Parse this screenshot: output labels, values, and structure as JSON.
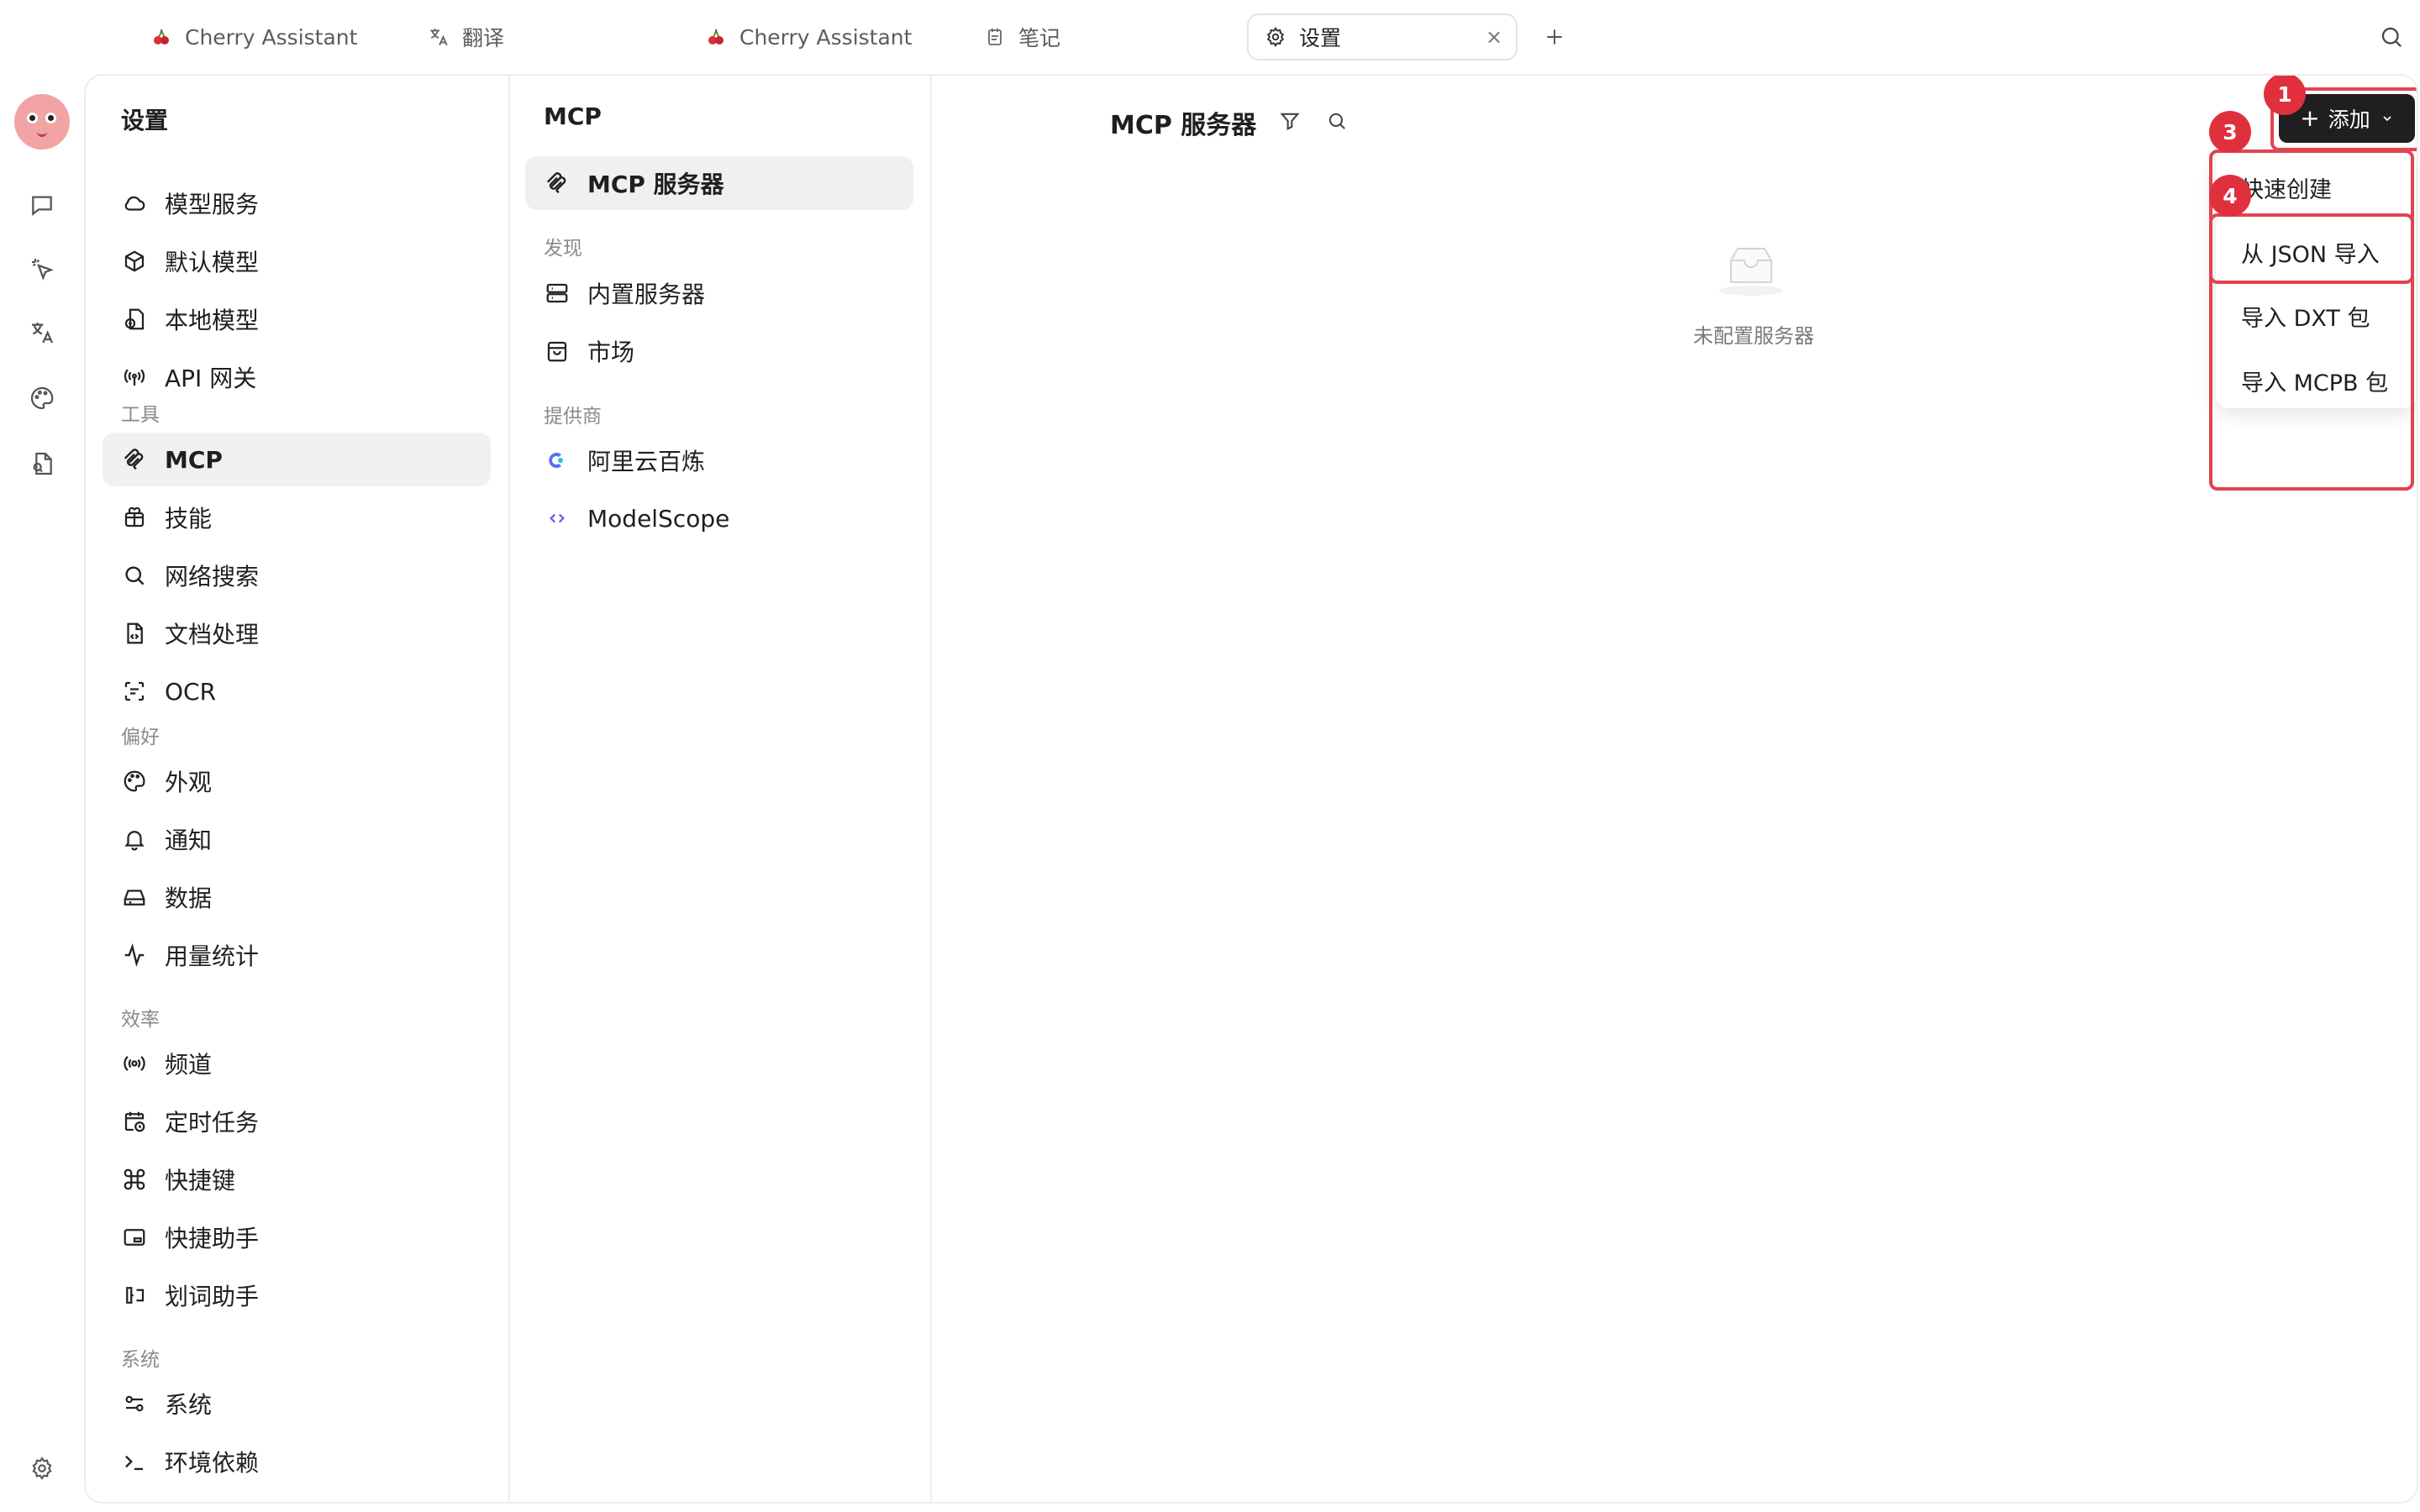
{
  "tabs": [
    {
      "label": "Cherry Assistant",
      "icon": "cherry-icon"
    },
    {
      "label": "翻译",
      "icon": "translate-icon"
    },
    {
      "label": "Cherry Assistant",
      "icon": "cherry-icon"
    },
    {
      "label": "笔记",
      "icon": "note-icon"
    },
    {
      "label": "设置",
      "icon": "gear-icon",
      "active": true
    }
  ],
  "tab_close": "×",
  "settings_nav": {
    "title": "设置",
    "items": [
      {
        "label": "模型服务",
        "icon": "cloud-icon"
      },
      {
        "label": "默认模型",
        "icon": "cube-icon"
      },
      {
        "label": "本地模型",
        "icon": "local-model-icon"
      },
      {
        "label": "API 网关",
        "icon": "antenna-icon"
      }
    ],
    "groups": [
      {
        "label": "工具",
        "items": [
          {
            "label": "MCP",
            "icon": "mcp-icon",
            "active": true
          },
          {
            "label": "技能",
            "icon": "gift-box-icon"
          },
          {
            "label": "网络搜索",
            "icon": "search-icon"
          },
          {
            "label": "文档处理",
            "icon": "document-icon"
          },
          {
            "label": "OCR",
            "icon": "ocr-scan-icon"
          }
        ]
      },
      {
        "label": "偏好",
        "items": [
          {
            "label": "外观",
            "icon": "palette-icon"
          },
          {
            "label": "通知",
            "icon": "bell-icon"
          },
          {
            "label": "数据",
            "icon": "hard-drive-icon"
          },
          {
            "label": "用量统计",
            "icon": "activity-icon"
          }
        ]
      },
      {
        "label": "效率",
        "items": [
          {
            "label": "频道",
            "icon": "broadcast-icon"
          },
          {
            "label": "定时任务",
            "icon": "calendar-clock-icon"
          },
          {
            "label": "快捷键",
            "icon": "command-icon"
          },
          {
            "label": "快捷助手",
            "icon": "quick-assistant-icon"
          },
          {
            "label": "划词助手",
            "icon": "text-select-icon"
          }
        ]
      },
      {
        "label": "系统",
        "items": [
          {
            "label": "系统",
            "icon": "sliders-icon"
          },
          {
            "label": "环境依赖",
            "icon": "terminal-icon"
          }
        ]
      }
    ]
  },
  "mcp_nav": {
    "title": "MCP",
    "servers_label": "MCP 服务器",
    "discover_label": "发现",
    "discover_items": [
      {
        "label": "内置服务器",
        "icon": "server-icon"
      },
      {
        "label": "市场",
        "icon": "shopping-bag-icon"
      }
    ],
    "providers_label": "提供商",
    "providers": [
      {
        "label": "阿里云百炼",
        "icon": "bailian-logo-icon"
      },
      {
        "label": "ModelScope",
        "icon": "modelscope-logo-icon"
      }
    ]
  },
  "main": {
    "title": "MCP 服务器",
    "empty_text": "未配置服务器",
    "add_button": "添加",
    "dropdown": [
      "快速创建",
      "从 JSON 导入",
      "导入 DXT 包",
      "导入 MCPB 包"
    ]
  },
  "annotations": [
    "1",
    "3",
    "4"
  ],
  "colors": {
    "accent_dark": "#1f1f1f",
    "annotation_red": "#e0303d",
    "active_bg": "#f0f0f0",
    "avatar": "#f2a3a3"
  }
}
